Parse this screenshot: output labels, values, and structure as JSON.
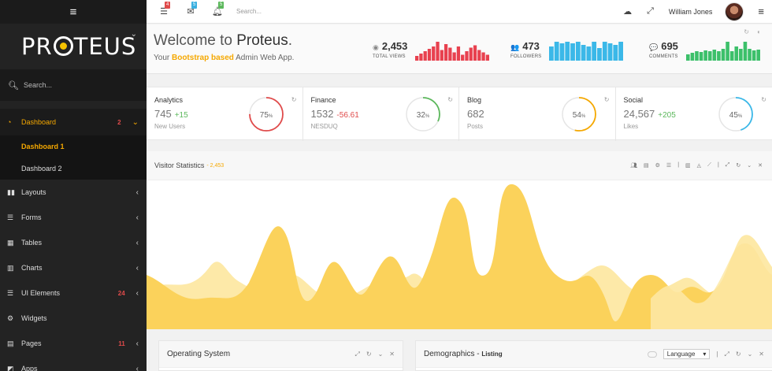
{
  "sidebar": {
    "menu_icon": "≡",
    "logo_text_start": "PR",
    "logo_text_end": "TEUS",
    "search_placeholder": "Search...",
    "items": [
      {
        "label": "Dashboard",
        "icon": "dashboard-icon",
        "glyph": "◔",
        "badge": "2",
        "arrow": "⌄",
        "active": true
      },
      {
        "label": "Layouts",
        "icon": "columns-icon",
        "glyph": "▮▮",
        "badge": "",
        "arrow": "‹"
      },
      {
        "label": "Forms",
        "icon": "list-icon",
        "glyph": "☰",
        "badge": "",
        "arrow": "‹"
      },
      {
        "label": "Tables",
        "icon": "table-icon",
        "glyph": "▦",
        "badge": "",
        "arrow": "‹"
      },
      {
        "label": "Charts",
        "icon": "bar-chart-icon",
        "glyph": "▥",
        "badge": "",
        "arrow": "‹"
      },
      {
        "label": "UI Elements",
        "icon": "list-alt-icon",
        "glyph": "☰",
        "badge": "24",
        "arrow": "‹"
      },
      {
        "label": "Widgets",
        "icon": "cogs-icon",
        "glyph": "⚙",
        "badge": "",
        "arrow": ""
      },
      {
        "label": "Pages",
        "icon": "file-icon",
        "glyph": "▤",
        "badge": "11",
        "arrow": "‹"
      },
      {
        "label": "Apps",
        "icon": "cubes-icon",
        "glyph": "◩",
        "badge": "",
        "arrow": "‹"
      }
    ],
    "dashboard_sub": [
      "Dashboard 1",
      "Dashboard 2"
    ]
  },
  "topbar": {
    "tasks_badge": "4",
    "messages_badge": "5",
    "notifications_badge": "5",
    "search_placeholder": "Search...",
    "user_name": "William Jones",
    "colors": {
      "red": "#e04b4b",
      "blue": "#3bb0e0",
      "green": "#5cb85c"
    }
  },
  "welcome": {
    "title_prefix": "Welcome to ",
    "title_brand": "Proteus",
    "title_suffix": ".",
    "subtitle_prefix": "Your ",
    "subtitle_highlight": "Bootstrap based",
    "subtitle_suffix": " Admin Web App."
  },
  "header_stats": [
    {
      "value": "2,453",
      "label": "TOTAL VIEWS",
      "icon": "eye-icon",
      "glyph": "◉",
      "color": "#e8414f",
      "bars": [
        4,
        6,
        8,
        10,
        12,
        16,
        9,
        14,
        11,
        7,
        12,
        5,
        8,
        11,
        13,
        9,
        7,
        5
      ]
    },
    {
      "value": "473",
      "label": "FOLLOWERS",
      "icon": "users-icon",
      "glyph": "👥",
      "color": "#3bb8e8",
      "bars": [
        18,
        24,
        22,
        24,
        22,
        24,
        20,
        18,
        24,
        16,
        24,
        22,
        20,
        24
      ]
    },
    {
      "value": "695",
      "label": "COMMENTS",
      "icon": "comments-icon",
      "glyph": "💬",
      "color": "#3cc06a",
      "bars": [
        8,
        10,
        12,
        11,
        13,
        12,
        14,
        12,
        15,
        24,
        12,
        18,
        15,
        24,
        15,
        13,
        14
      ]
    }
  ],
  "cards": [
    {
      "title": "Analytics",
      "value": "745",
      "change": "+15",
      "change_color": "#5cb85c",
      "sub": "New Users",
      "percent": 75,
      "ring_color": "#e04b4b"
    },
    {
      "title": "Finance",
      "value": "1532",
      "change": "-56.61",
      "change_color": "#e04b4b",
      "sub": "NESDUQ",
      "percent": 32,
      "ring_color": "#5cb85c"
    },
    {
      "title": "Blog",
      "value": "682",
      "change": "",
      "change_color": "#999",
      "sub": "Posts",
      "percent": 54,
      "ring_color": "#f5a800"
    },
    {
      "title": "Social",
      "value": "24,567",
      "change": "+205",
      "change_color": "#5cb85c",
      "sub": "Likes",
      "percent": 45,
      "ring_color": "#3bb8e8"
    }
  ],
  "visitor": {
    "title": "Visitor Statistics",
    "count": "- 2,453",
    "colors": {
      "primary": "#fbd25b",
      "secondary": "#fde9a8"
    }
  },
  "panels": {
    "os_title": "Operating System",
    "demo_title": "Demographics",
    "demo_sub": "Listing",
    "demo_sep": " - ",
    "language_label": "Language"
  }
}
